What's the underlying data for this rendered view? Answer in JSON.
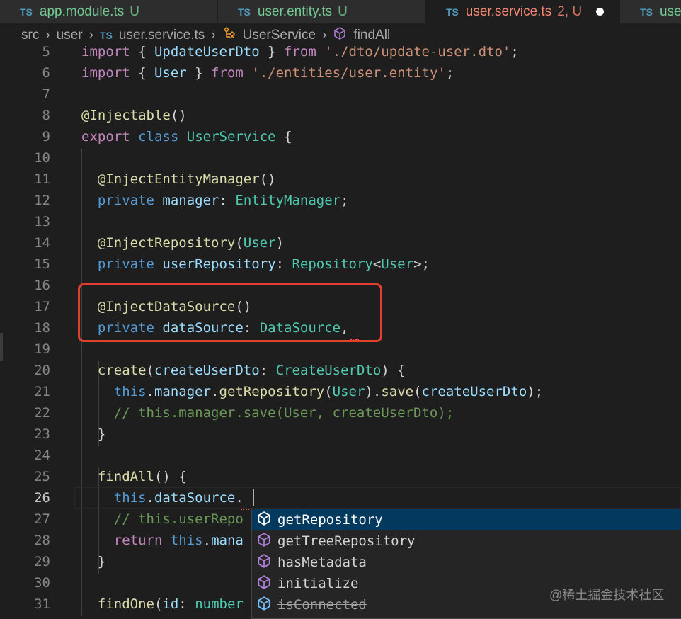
{
  "tabs": [
    {
      "label": "app.module.ts",
      "badge": "U",
      "active": false
    },
    {
      "label": "user.entity.ts",
      "badge": "U",
      "active": false
    },
    {
      "label": "user.service.ts",
      "badge": "2, U",
      "active": true,
      "modified": true
    },
    {
      "label": "user.mo",
      "badge": "",
      "active": false
    }
  ],
  "breadcrumb": [
    "src",
    "user",
    "user.service.ts",
    "UserService",
    "findAll"
  ],
  "current_line": 26,
  "lines": [
    {
      "n": 5,
      "t": [
        [
          "import",
          "kw"
        ],
        [
          " { ",
          "pu"
        ],
        [
          "UpdateUserDto",
          "va"
        ],
        [
          " } ",
          "pu"
        ],
        [
          "from",
          "kw"
        ],
        [
          " ",
          "pu"
        ],
        [
          "'./dto/update-user.dto'",
          "str"
        ],
        [
          ";",
          "pu"
        ]
      ]
    },
    {
      "n": 6,
      "t": [
        [
          "import",
          "kw"
        ],
        [
          " { ",
          "pu"
        ],
        [
          "User",
          "va"
        ],
        [
          " } ",
          "pu"
        ],
        [
          "from",
          "kw"
        ],
        [
          " ",
          "pu"
        ],
        [
          "'./entities/user.entity'",
          "str"
        ],
        [
          ";",
          "pu"
        ]
      ]
    },
    {
      "n": 7,
      "t": []
    },
    {
      "n": 8,
      "t": [
        [
          "@Injectable",
          "fn"
        ],
        [
          "()",
          "pu"
        ]
      ]
    },
    {
      "n": 9,
      "t": [
        [
          "export",
          "kw"
        ],
        [
          " ",
          "pu"
        ],
        [
          "class",
          "st"
        ],
        [
          " ",
          "pu"
        ],
        [
          "UserService",
          "ty"
        ],
        [
          " {",
          "pu"
        ]
      ]
    },
    {
      "n": 10,
      "t": []
    },
    {
      "n": 11,
      "t": [
        [
          "  @InjectEntityManager",
          "fn"
        ],
        [
          "()",
          "pu"
        ]
      ]
    },
    {
      "n": 12,
      "t": [
        [
          "  private",
          "st"
        ],
        [
          " ",
          "pu"
        ],
        [
          "manager",
          "va"
        ],
        [
          ": ",
          "pu"
        ],
        [
          "EntityManager",
          "ty"
        ],
        [
          ";",
          "pu"
        ]
      ]
    },
    {
      "n": 13,
      "t": []
    },
    {
      "n": 14,
      "t": [
        [
          "  @InjectRepository",
          "fn"
        ],
        [
          "(",
          "pu"
        ],
        [
          "User",
          "ty"
        ],
        [
          ")",
          "pu"
        ]
      ]
    },
    {
      "n": 15,
      "t": [
        [
          "  private",
          "st"
        ],
        [
          " ",
          "pu"
        ],
        [
          "userRepository",
          "va"
        ],
        [
          ": ",
          "pu"
        ],
        [
          "Repository",
          "ty"
        ],
        [
          "<",
          "pu"
        ],
        [
          "User",
          "ty"
        ],
        [
          ">;",
          "pu"
        ]
      ]
    },
    {
      "n": 16,
      "t": []
    },
    {
      "n": 17,
      "t": [
        [
          "  @InjectDataSource",
          "fn"
        ],
        [
          "()",
          "pu"
        ]
      ]
    },
    {
      "n": 18,
      "t": [
        [
          "  private",
          "st"
        ],
        [
          " ",
          "pu"
        ],
        [
          "dataSource",
          "va"
        ],
        [
          ": ",
          "pu"
        ],
        [
          "DataSource",
          "ty"
        ],
        [
          ",",
          "pu"
        ]
      ]
    },
    {
      "n": 19,
      "t": []
    },
    {
      "n": 20,
      "t": [
        [
          "  create",
          "fn"
        ],
        [
          "(",
          "pu"
        ],
        [
          "createUserDto",
          "va"
        ],
        [
          ": ",
          "pu"
        ],
        [
          "CreateUserDto",
          "ty"
        ],
        [
          ") {",
          "pu"
        ]
      ]
    },
    {
      "n": 21,
      "t": [
        [
          "    this",
          "st"
        ],
        [
          ".",
          "pu"
        ],
        [
          "manager",
          "va"
        ],
        [
          ".",
          "pu"
        ],
        [
          "getRepository",
          "fn"
        ],
        [
          "(",
          "pu"
        ],
        [
          "User",
          "ty"
        ],
        [
          ").",
          "pu"
        ],
        [
          "save",
          "fn"
        ],
        [
          "(",
          "pu"
        ],
        [
          "createUserDto",
          "va"
        ],
        [
          ");",
          "pu"
        ]
      ]
    },
    {
      "n": 22,
      "t": [
        [
          "    // this.manager.save(User, createUserDto);",
          "cm"
        ]
      ]
    },
    {
      "n": 23,
      "t": [
        [
          "  }",
          "pu"
        ]
      ]
    },
    {
      "n": 24,
      "t": []
    },
    {
      "n": 25,
      "t": [
        [
          "  findAll",
          "fn"
        ],
        [
          "() {",
          "pu"
        ]
      ]
    },
    {
      "n": 26,
      "t": [
        [
          "    this",
          "st"
        ],
        [
          ".",
          "pu"
        ],
        [
          "dataSource",
          "va"
        ],
        [
          ".",
          "pu"
        ]
      ]
    },
    {
      "n": 27,
      "t": [
        [
          "    // this.userRepo",
          "cm"
        ]
      ]
    },
    {
      "n": 28,
      "t": [
        [
          "    return",
          "kw"
        ],
        [
          " ",
          "pu"
        ],
        [
          "this",
          "st"
        ],
        [
          ".",
          "pu"
        ],
        [
          "mana",
          "va"
        ]
      ]
    },
    {
      "n": 29,
      "t": [
        [
          "  }",
          "pu"
        ]
      ]
    },
    {
      "n": 30,
      "t": []
    },
    {
      "n": 31,
      "t": [
        [
          "  findOne",
          "fn"
        ],
        [
          "(",
          "pu"
        ],
        [
          "id",
          "va"
        ],
        [
          ": ",
          "pu"
        ],
        [
          "number",
          "ty"
        ]
      ]
    }
  ],
  "suggestions": [
    {
      "label": "getRepository",
      "icon": "method-cube-icon",
      "selected": true
    },
    {
      "label": "getTreeRepository",
      "icon": "method-cube-icon"
    },
    {
      "label": "hasMetadata",
      "icon": "method-cube-icon"
    },
    {
      "label": "initialize",
      "icon": "method-cube-icon"
    },
    {
      "label": "isConnected",
      "icon": "field-cube-icon",
      "deprecated": true
    }
  ],
  "colors": {
    "highlight_box": "#e0402d",
    "selected_suggestion": "#04395e",
    "method_icon": "#b180d7",
    "field_icon": "#75beff"
  },
  "watermark": "@稀土掘金技术社区"
}
